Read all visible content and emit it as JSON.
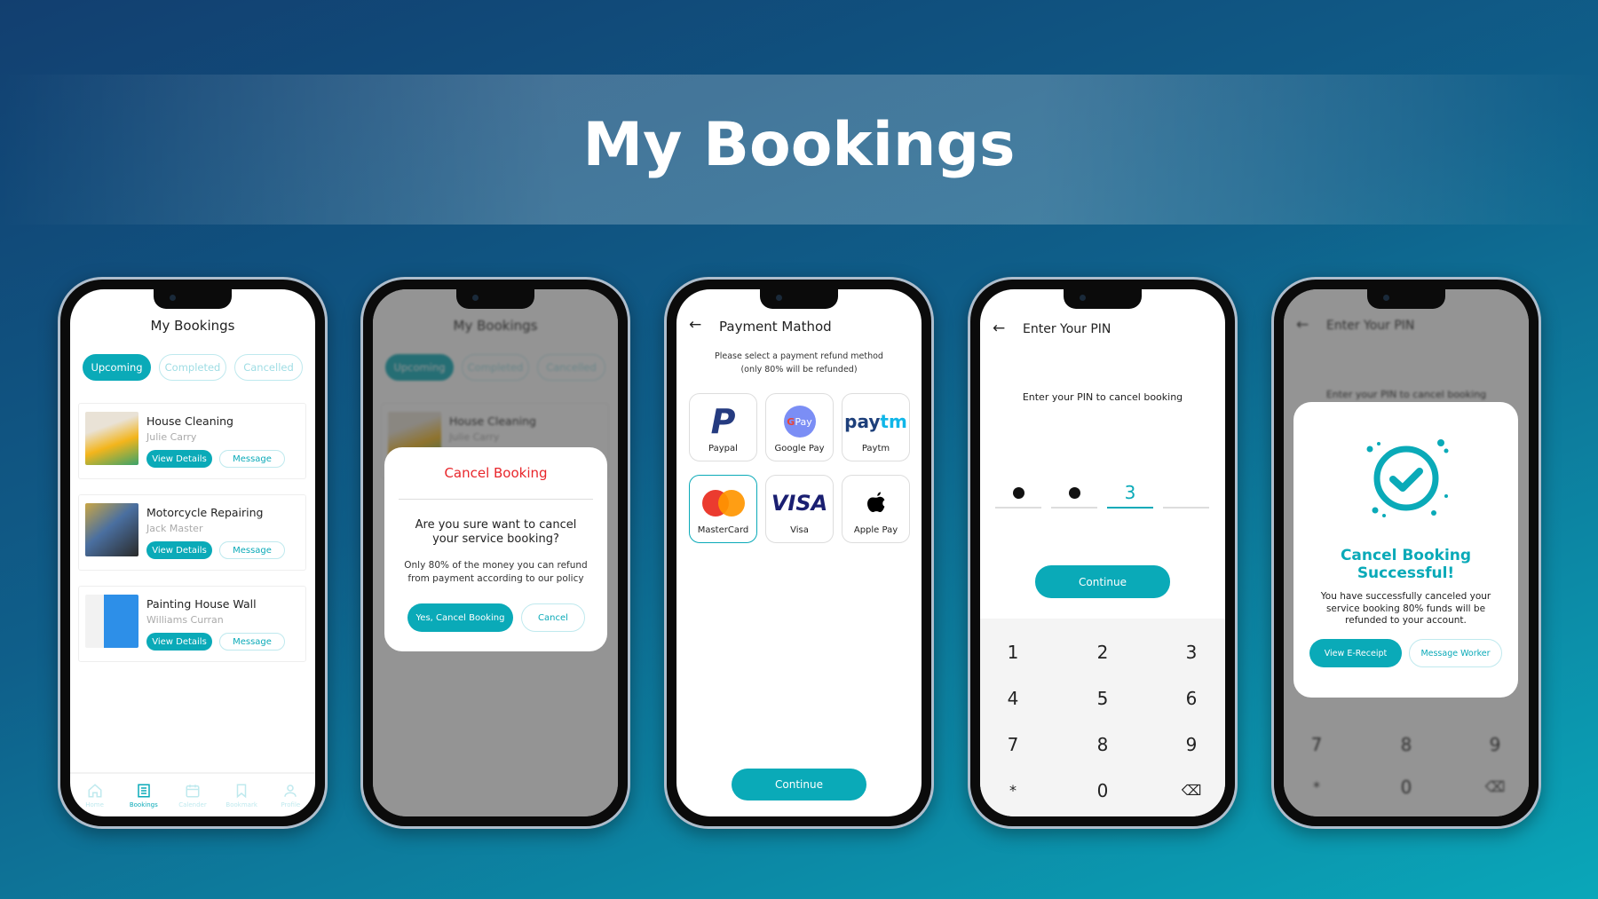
{
  "page_title": "My Bookings",
  "colors": {
    "accent": "#0aaab8",
    "danger": "#e8262b",
    "bg_dark": "#123f70",
    "bg_light": "#0aa7b9"
  },
  "bookings_screen": {
    "title": "My Bookings",
    "tabs": [
      {
        "label": "Upcoming",
        "active": true
      },
      {
        "label": "Completed",
        "active": false
      },
      {
        "label": "Cancelled",
        "active": false
      }
    ],
    "items": [
      {
        "title": "House Cleaning",
        "worker": "Julie Carry",
        "view": "View Details",
        "message": "Message"
      },
      {
        "title": "Motorcycle Repairing",
        "worker": "Jack Master",
        "view": "View Details",
        "message": "Message"
      },
      {
        "title": "Painting House Wall",
        "worker": "Williams Curran",
        "view": "View Details",
        "message": "Message"
      }
    ],
    "nav": [
      {
        "label": "Home",
        "icon": "home-icon"
      },
      {
        "label": "Bookings",
        "icon": "bookings-icon",
        "active": true
      },
      {
        "label": "Calender",
        "icon": "calendar-icon"
      },
      {
        "label": "Bookmark",
        "icon": "bookmark-icon"
      },
      {
        "label": "Profile",
        "icon": "profile-icon"
      }
    ]
  },
  "cancel_dialog": {
    "title": "Cancel Booking",
    "question": "Are you sure want to cancel your service booking?",
    "note": "Only 80% of the money you can refund from payment according to our policy",
    "confirm": "Yes, Cancel Booking",
    "cancel": "Cancel"
  },
  "payment_screen": {
    "title": "Payment Mathod",
    "subtitle": "Please select a payment refund method",
    "subtitle2": "(only 80% will be refunded)",
    "methods": [
      {
        "label": "Paypal"
      },
      {
        "label": "Google Pay"
      },
      {
        "label": "Paytm"
      },
      {
        "label": "MasterCard",
        "selected": true
      },
      {
        "label": "Visa"
      },
      {
        "label": "Apple Pay"
      }
    ],
    "continue": "Continue"
  },
  "pin_screen": {
    "title": "Enter Your PIN",
    "subtitle": "Enter your PIN to cancel booking",
    "pin_third_digit": "3",
    "continue": "Continue",
    "keys": [
      "1",
      "2",
      "3",
      "4",
      "5",
      "6",
      "7",
      "8",
      "9",
      "*",
      "0"
    ]
  },
  "success_dialog": {
    "title": "Cancel Booking Successful!",
    "message": "You have successfully canceled your service booking 80% funds will be refunded to your account.",
    "receipt": "View E-Receipt",
    "message_worker": "Message Worker"
  }
}
